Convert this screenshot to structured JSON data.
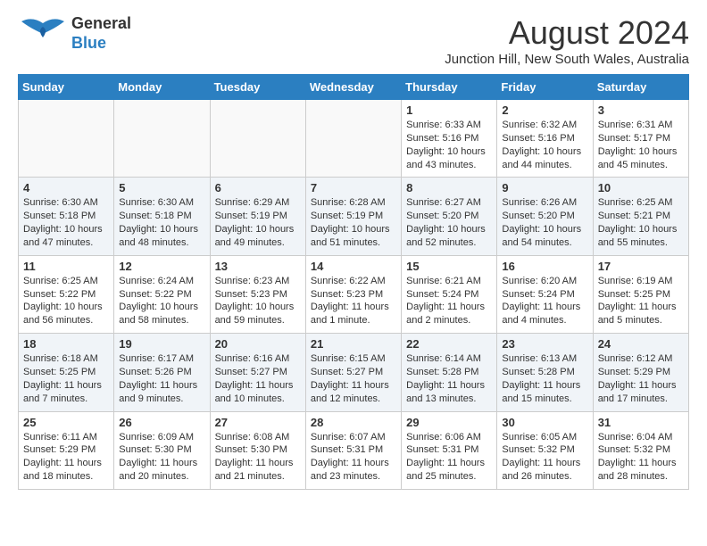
{
  "logo": {
    "line1": "General",
    "line2": "Blue"
  },
  "title": "August 2024",
  "subtitle": "Junction Hill, New South Wales, Australia",
  "days_of_week": [
    "Sunday",
    "Monday",
    "Tuesday",
    "Wednesday",
    "Thursday",
    "Friday",
    "Saturday"
  ],
  "weeks": [
    [
      {
        "day": "",
        "content": ""
      },
      {
        "day": "",
        "content": ""
      },
      {
        "day": "",
        "content": ""
      },
      {
        "day": "",
        "content": ""
      },
      {
        "day": "1",
        "content": "Sunrise: 6:33 AM\nSunset: 5:16 PM\nDaylight: 10 hours\nand 43 minutes."
      },
      {
        "day": "2",
        "content": "Sunrise: 6:32 AM\nSunset: 5:16 PM\nDaylight: 10 hours\nand 44 minutes."
      },
      {
        "day": "3",
        "content": "Sunrise: 6:31 AM\nSunset: 5:17 PM\nDaylight: 10 hours\nand 45 minutes."
      }
    ],
    [
      {
        "day": "4",
        "content": "Sunrise: 6:30 AM\nSunset: 5:18 PM\nDaylight: 10 hours\nand 47 minutes."
      },
      {
        "day": "5",
        "content": "Sunrise: 6:30 AM\nSunset: 5:18 PM\nDaylight: 10 hours\nand 48 minutes."
      },
      {
        "day": "6",
        "content": "Sunrise: 6:29 AM\nSunset: 5:19 PM\nDaylight: 10 hours\nand 49 minutes."
      },
      {
        "day": "7",
        "content": "Sunrise: 6:28 AM\nSunset: 5:19 PM\nDaylight: 10 hours\nand 51 minutes."
      },
      {
        "day": "8",
        "content": "Sunrise: 6:27 AM\nSunset: 5:20 PM\nDaylight: 10 hours\nand 52 minutes."
      },
      {
        "day": "9",
        "content": "Sunrise: 6:26 AM\nSunset: 5:20 PM\nDaylight: 10 hours\nand 54 minutes."
      },
      {
        "day": "10",
        "content": "Sunrise: 6:25 AM\nSunset: 5:21 PM\nDaylight: 10 hours\nand 55 minutes."
      }
    ],
    [
      {
        "day": "11",
        "content": "Sunrise: 6:25 AM\nSunset: 5:22 PM\nDaylight: 10 hours\nand 56 minutes."
      },
      {
        "day": "12",
        "content": "Sunrise: 6:24 AM\nSunset: 5:22 PM\nDaylight: 10 hours\nand 58 minutes."
      },
      {
        "day": "13",
        "content": "Sunrise: 6:23 AM\nSunset: 5:23 PM\nDaylight: 10 hours\nand 59 minutes."
      },
      {
        "day": "14",
        "content": "Sunrise: 6:22 AM\nSunset: 5:23 PM\nDaylight: 11 hours\nand 1 minute."
      },
      {
        "day": "15",
        "content": "Sunrise: 6:21 AM\nSunset: 5:24 PM\nDaylight: 11 hours\nand 2 minutes."
      },
      {
        "day": "16",
        "content": "Sunrise: 6:20 AM\nSunset: 5:24 PM\nDaylight: 11 hours\nand 4 minutes."
      },
      {
        "day": "17",
        "content": "Sunrise: 6:19 AM\nSunset: 5:25 PM\nDaylight: 11 hours\nand 5 minutes."
      }
    ],
    [
      {
        "day": "18",
        "content": "Sunrise: 6:18 AM\nSunset: 5:25 PM\nDaylight: 11 hours\nand 7 minutes."
      },
      {
        "day": "19",
        "content": "Sunrise: 6:17 AM\nSunset: 5:26 PM\nDaylight: 11 hours\nand 9 minutes."
      },
      {
        "day": "20",
        "content": "Sunrise: 6:16 AM\nSunset: 5:27 PM\nDaylight: 11 hours\nand 10 minutes."
      },
      {
        "day": "21",
        "content": "Sunrise: 6:15 AM\nSunset: 5:27 PM\nDaylight: 11 hours\nand 12 minutes."
      },
      {
        "day": "22",
        "content": "Sunrise: 6:14 AM\nSunset: 5:28 PM\nDaylight: 11 hours\nand 13 minutes."
      },
      {
        "day": "23",
        "content": "Sunrise: 6:13 AM\nSunset: 5:28 PM\nDaylight: 11 hours\nand 15 minutes."
      },
      {
        "day": "24",
        "content": "Sunrise: 6:12 AM\nSunset: 5:29 PM\nDaylight: 11 hours\nand 17 minutes."
      }
    ],
    [
      {
        "day": "25",
        "content": "Sunrise: 6:11 AM\nSunset: 5:29 PM\nDaylight: 11 hours\nand 18 minutes."
      },
      {
        "day": "26",
        "content": "Sunrise: 6:09 AM\nSunset: 5:30 PM\nDaylight: 11 hours\nand 20 minutes."
      },
      {
        "day": "27",
        "content": "Sunrise: 6:08 AM\nSunset: 5:30 PM\nDaylight: 11 hours\nand 21 minutes."
      },
      {
        "day": "28",
        "content": "Sunrise: 6:07 AM\nSunset: 5:31 PM\nDaylight: 11 hours\nand 23 minutes."
      },
      {
        "day": "29",
        "content": "Sunrise: 6:06 AM\nSunset: 5:31 PM\nDaylight: 11 hours\nand 25 minutes."
      },
      {
        "day": "30",
        "content": "Sunrise: 6:05 AM\nSunset: 5:32 PM\nDaylight: 11 hours\nand 26 minutes."
      },
      {
        "day": "31",
        "content": "Sunrise: 6:04 AM\nSunset: 5:32 PM\nDaylight: 11 hours\nand 28 minutes."
      }
    ]
  ]
}
